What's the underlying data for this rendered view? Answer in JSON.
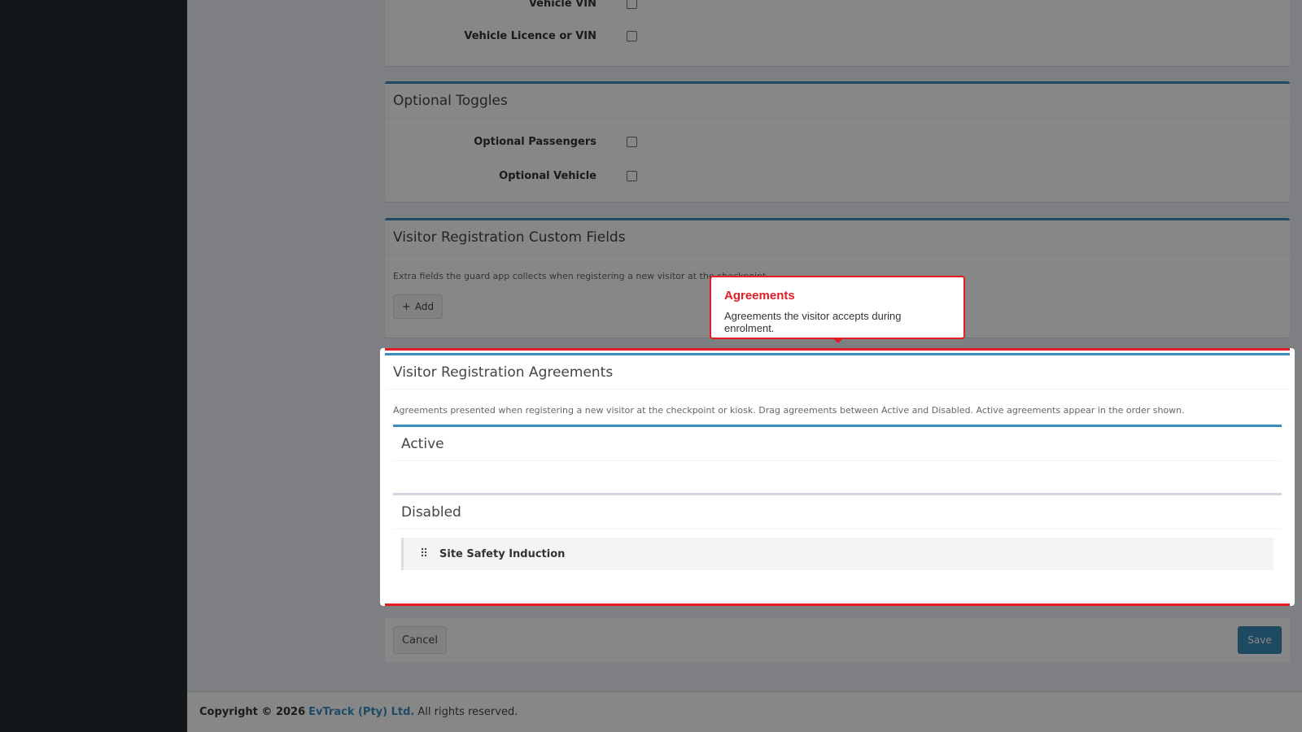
{
  "vehicle_section": {
    "rows": [
      {
        "label": "Vehicle VIN"
      },
      {
        "label": "Vehicle Licence or VIN"
      }
    ]
  },
  "optional_toggles": {
    "title": "Optional Toggles",
    "rows": [
      {
        "label": "Optional Passengers"
      },
      {
        "label": "Optional Vehicle"
      }
    ]
  },
  "custom_fields": {
    "title": "Visitor Registration Custom Fields",
    "help": "Extra fields the guard app collects when registering a new visitor at the checkpoint.",
    "add_label": "Add",
    "add_icon": "plus-icon"
  },
  "agreements": {
    "title": "Visitor Registration Agreements",
    "help": "Agreements presented when registering a new visitor at the checkpoint or kiosk. Drag agreements between Active and Disabled. Active agreements appear in the order shown.",
    "active_title": "Active",
    "disabled_title": "Disabled",
    "disabled_items": [
      {
        "label": "Site Safety Induction",
        "icon": "drag-handle-icon"
      }
    ]
  },
  "tooltip": {
    "title": "Agreements",
    "body": "Agreements the visitor accepts during enrolment."
  },
  "actions": {
    "cancel_label": "Cancel",
    "save_label": "Save"
  },
  "footer": {
    "copyright": "Copyright © 2026",
    "company": "EvTrack (Pty) Ltd.",
    "rights": "All rights reserved."
  },
  "colors": {
    "accent": "#3c8dbc",
    "highlight": "#e31c25",
    "sidebar": "#222d32"
  }
}
